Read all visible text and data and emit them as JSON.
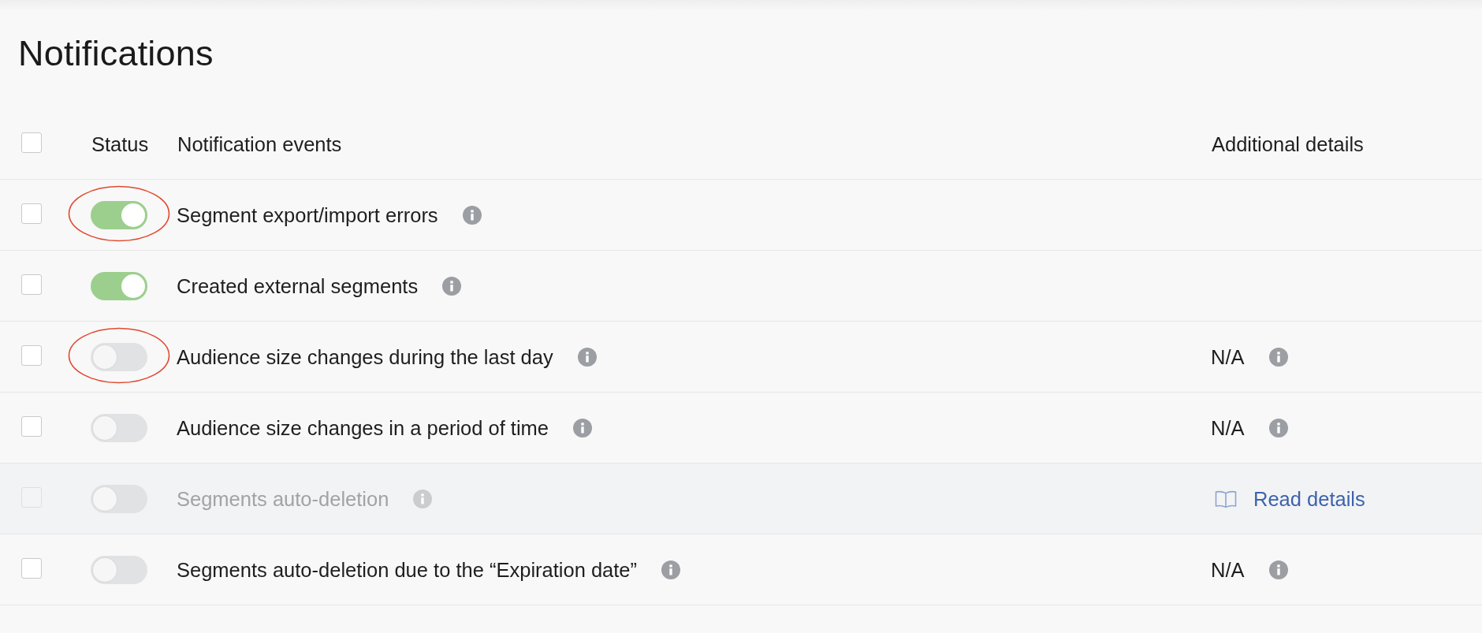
{
  "page": {
    "title": "Notifications"
  },
  "table": {
    "select_all": {
      "checked": false
    },
    "columns": [
      "Status",
      "Notification events",
      "Additional details"
    ],
    "rows": [
      {
        "checked": false,
        "on": true,
        "circled": true,
        "disabled": false,
        "event": "Segment export/import errors"
      },
      {
        "checked": false,
        "on": true,
        "circled": false,
        "disabled": false,
        "event": "Created external segments"
      },
      {
        "checked": false,
        "on": false,
        "circled": true,
        "disabled": false,
        "event": "Audience size changes during the last day",
        "details": {
          "kind": "note",
          "text": "N/A"
        }
      },
      {
        "checked": false,
        "on": false,
        "circled": false,
        "disabled": false,
        "event": "Audience size changes in a period of time",
        "details": {
          "kind": "note",
          "text": "N/A"
        }
      },
      {
        "checked": false,
        "on": false,
        "circled": false,
        "disabled": true,
        "event": "Segments auto-deletion",
        "details": {
          "kind": "link",
          "text": "Read details"
        }
      },
      {
        "checked": false,
        "on": false,
        "circled": false,
        "disabled": false,
        "event": "Segments auto-deletion due to the “Expiration date”",
        "details": {
          "kind": "note",
          "text": "N/A"
        }
      }
    ]
  }
}
